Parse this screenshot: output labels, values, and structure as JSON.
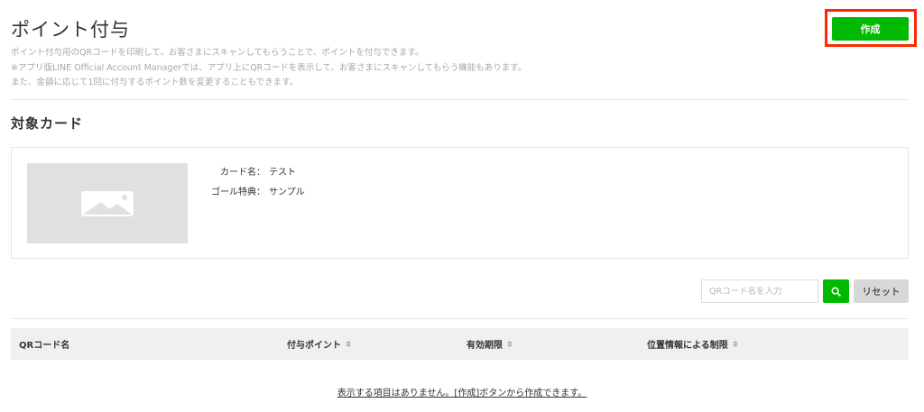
{
  "header": {
    "title": "ポイント付与",
    "description_lines": [
      "ポイント付与用のQRコードを印刷して、お客さまにスキャンしてもらうことで、ポイントを付与できます。",
      "※アプリ版LINE Official Account Managerでは、アプリ上にQRコードを表示して、お客さまにスキャンしてもらう機能もあります。",
      "また、金額に応じて1回に付与するポイント数を変更することもできます。"
    ],
    "create_label": "作成"
  },
  "target_card": {
    "section_title": "対象カード",
    "image_icon": "image-placeholder-icon",
    "fields": [
      {
        "label": "カード名：",
        "value": "テスト"
      },
      {
        "label": "ゴール特典：",
        "value": "サンプル"
      }
    ]
  },
  "search": {
    "placeholder": "QRコード名を入力",
    "search_icon": "search-icon",
    "reset_label": "リセット"
  },
  "table": {
    "columns": [
      {
        "label": "QRコード名",
        "sortable": false
      },
      {
        "label": "付与ポイント",
        "sortable": true
      },
      {
        "label": "有効期限",
        "sortable": true
      },
      {
        "label": "位置情報による制限",
        "sortable": true
      }
    ],
    "rows": [],
    "empty_message": "表示する項目はありません。[作成]ボタンから作成できます。"
  },
  "colors": {
    "accent": "#00b900",
    "highlight": "#ff2a00"
  }
}
